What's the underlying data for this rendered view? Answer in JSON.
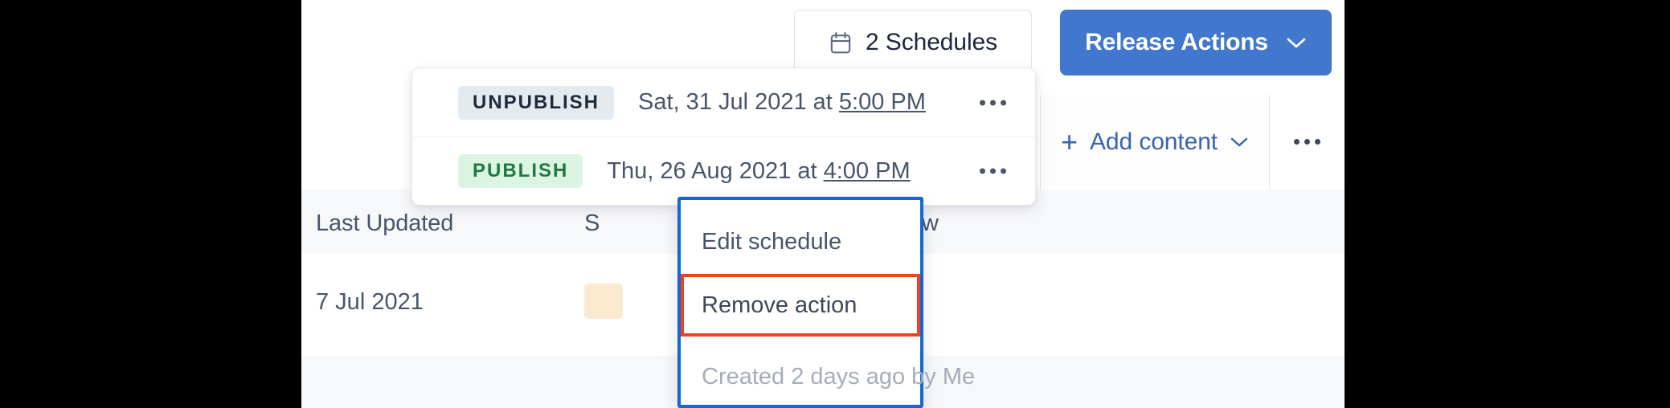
{
  "toolbar": {
    "schedules_button": {
      "label": "2 Schedules",
      "icon": "calendar-icon"
    },
    "release_actions_button": {
      "label": "Release Actions",
      "icon": "chevron-down-icon",
      "color": "#4178cd"
    }
  },
  "subbar": {
    "add_content": {
      "plus": "+",
      "label": "Add content",
      "icon": "chevron-down-icon"
    },
    "overflow_icon": "kebab-menu-icon"
  },
  "schedules_popup": {
    "rows": [
      {
        "badge": "UNPUBLISH",
        "badge_color": "#e4eaee",
        "date": "Sat, 31 Jul 2021 at ",
        "time": "5:00 PM",
        "overflow_icon": "kebab-menu-icon"
      },
      {
        "badge": "PUBLISH",
        "badge_color": "#dcf4e2",
        "date": "Thu, 26 Aug 2021 at ",
        "time": "4:00 PM",
        "overflow_icon": "kebab-menu-icon"
      }
    ]
  },
  "context_menu": {
    "border_color": "#1667d4",
    "highlight_color": "#ef4123",
    "items": [
      {
        "label": "Edit schedule"
      },
      {
        "label": "Remove action"
      },
      {
        "label": "Created 2 days ago by Me"
      }
    ]
  },
  "table": {
    "headers": [
      "Last Updated",
      "S",
      "Workflow"
    ],
    "rows": [
      {
        "last_updated": "7 Jul 2021",
        "status": "",
        "workflow": "-"
      }
    ]
  }
}
